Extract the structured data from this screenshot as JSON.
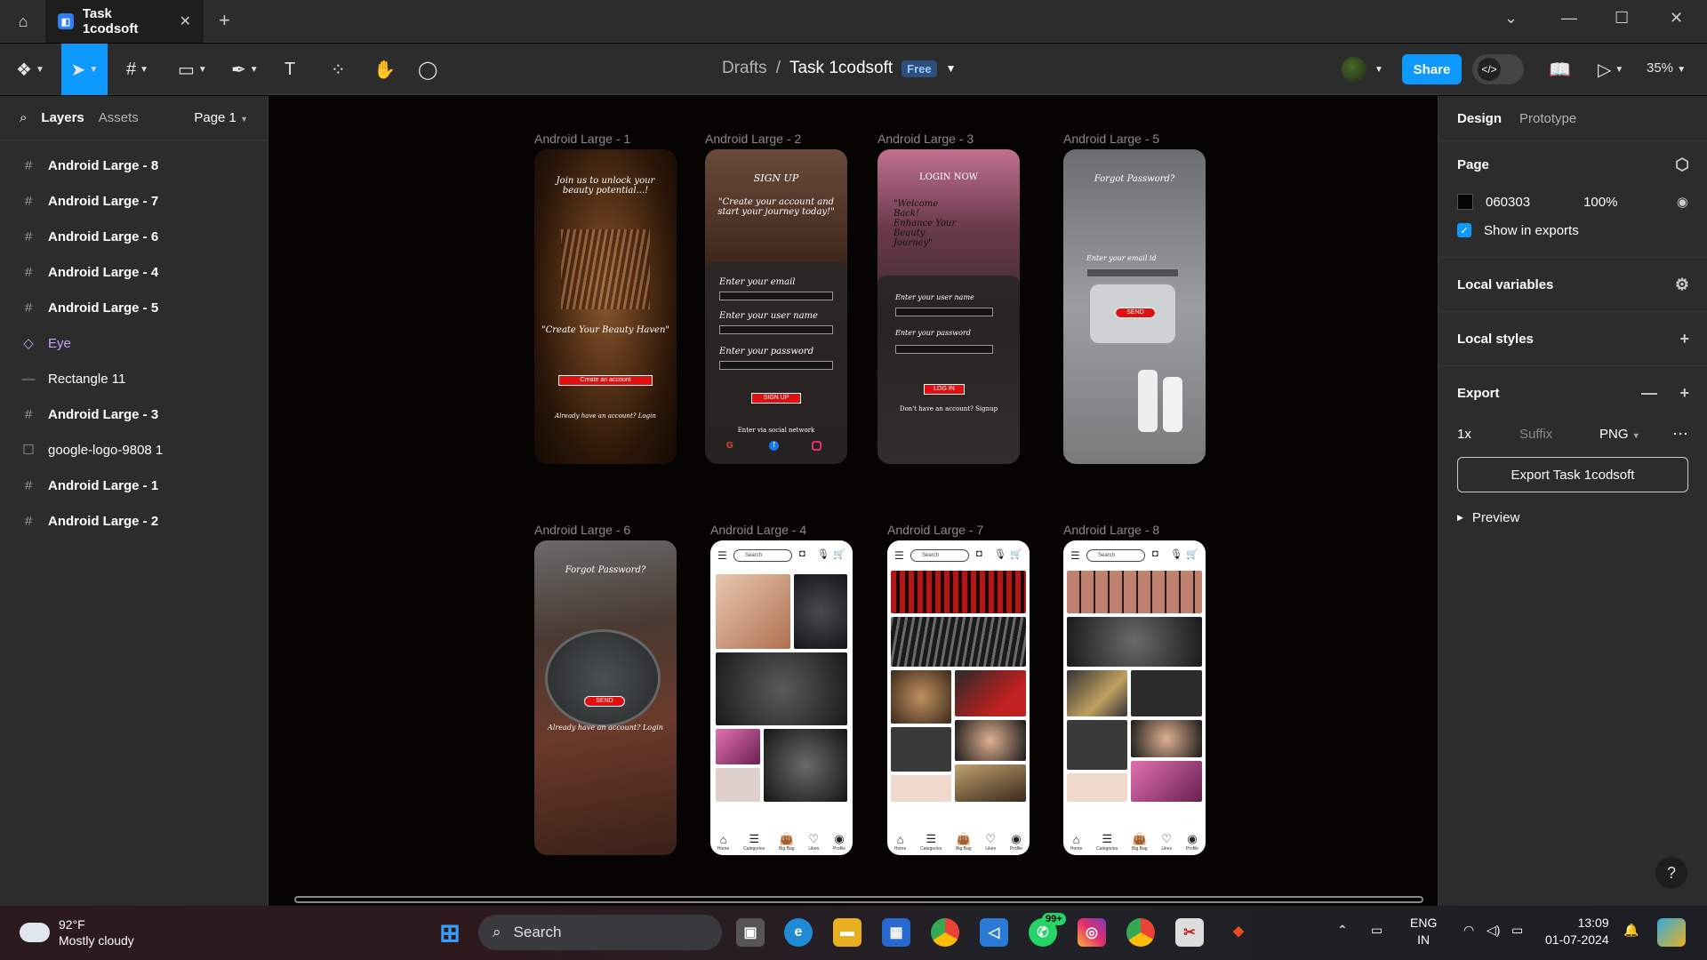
{
  "tab": {
    "title": "Task 1codsoft",
    "close": "✕",
    "add": "+"
  },
  "breadcrumb": {
    "drafts": "Drafts",
    "sep": "/",
    "file": "Task 1codsoft",
    "badge": "Free"
  },
  "toolbar": {
    "share": "Share",
    "zoom": "35%"
  },
  "left_panel": {
    "tab_layers": "Layers",
    "tab_assets": "Assets",
    "page": "Page 1",
    "layers": [
      {
        "label": "Android Large - 8",
        "icon": "frame-icon"
      },
      {
        "label": "Android Large - 7",
        "icon": "frame-icon"
      },
      {
        "label": "Android Large - 6",
        "icon": "frame-icon"
      },
      {
        "label": "Android Large - 4",
        "icon": "frame-icon"
      },
      {
        "label": "Android Large - 5",
        "icon": "frame-icon"
      },
      {
        "label": "Eye",
        "icon": "component-icon"
      },
      {
        "label": "Rectangle 11",
        "icon": "line-icon"
      },
      {
        "label": "Android Large - 3",
        "icon": "frame-icon"
      },
      {
        "label": "google-logo-9808 1",
        "icon": "image-icon"
      },
      {
        "label": "Android Large - 1",
        "icon": "frame-icon"
      },
      {
        "label": "Android Large - 2",
        "icon": "frame-icon"
      }
    ]
  },
  "canvas": {
    "frames": [
      {
        "label": "Android Large - 1"
      },
      {
        "label": "Android Large - 2"
      },
      {
        "label": "Android Large - 3"
      },
      {
        "label": "Android Large - 5"
      },
      {
        "label": "Android Large - 6"
      },
      {
        "label": "Android Large - 4"
      },
      {
        "label": "Android Large - 7"
      },
      {
        "label": "Android Large - 8"
      }
    ],
    "f1": {
      "t1": "Join us to unlock your beauty potential...!",
      "t2": "\"Create Your Beauty Haven\"",
      "btn": "Create an account",
      "foot": "Already have an account? Login"
    },
    "f2": {
      "t1": "SIGN UP",
      "t2": "\"Create your account and start your journey today!\"",
      "l1": "Enter your email",
      "l2": "Enter your user name",
      "l3": "Enter your password",
      "btn": "SIGN UP",
      "foot": "Enter via social network"
    },
    "f3": {
      "t1": "LOGIN NOW",
      "t2": "\"Welcome Back! Enhance Your Beauty Journey\"",
      "l1": "Enter your user name",
      "l2": "Enter your password",
      "btn": "LOG IN",
      "foot": "Don't have an account? Signup"
    },
    "f5": {
      "t1": "Forgot Password?",
      "l1": "Enter your email id",
      "btn": "SEND"
    },
    "f6": {
      "t1": "Forgot Password?",
      "btn": "SEND",
      "foot": "Already have an account? Login"
    },
    "shop": {
      "search": "Search",
      "nav": [
        "Home",
        "Categories",
        "Big Bag",
        "Likes",
        "Profile"
      ]
    }
  },
  "right_panel": {
    "tab_design": "Design",
    "tab_prototype": "Prototype",
    "page_title": "Page",
    "color_hex": "060303",
    "opacity": "100%",
    "show_exports": "Show in exports",
    "local_variables": "Local variables",
    "local_styles": "Local styles",
    "export_title": "Export",
    "scale": "1x",
    "suffix": "Suffix",
    "format": "PNG",
    "export_btn": "Export Task 1codsoft",
    "preview": "Preview",
    "help": "?"
  },
  "taskbar": {
    "temp": "92°F",
    "weather": "Mostly cloudy",
    "search": "Search",
    "lang1": "ENG",
    "lang2": "IN",
    "time": "13:09",
    "date": "01-07-2024",
    "badge": "99+"
  },
  "colors": {
    "accent": "#0d99ff",
    "canvas_bg": "#060303"
  }
}
